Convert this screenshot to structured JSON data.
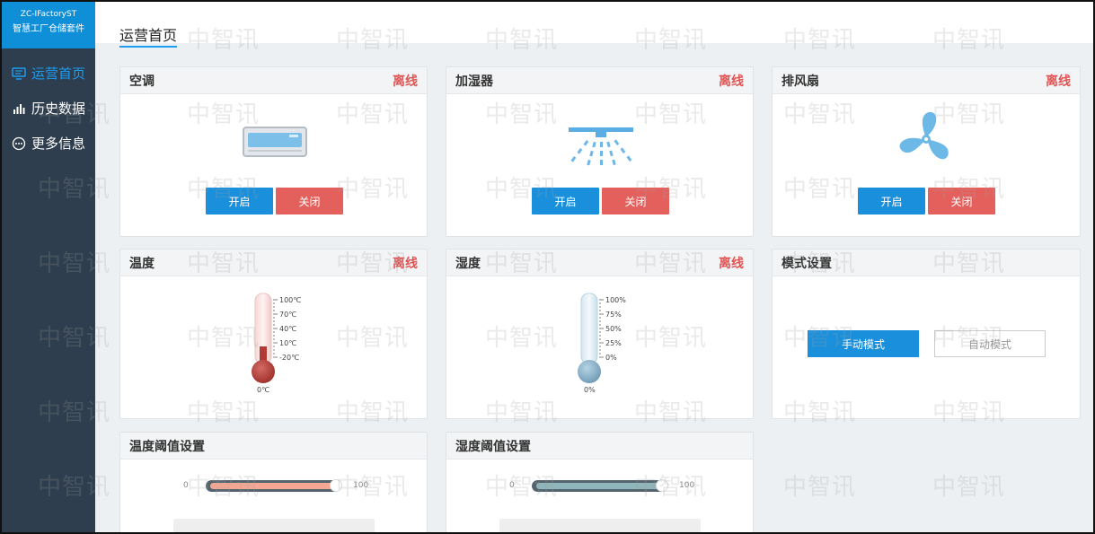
{
  "sidebar": {
    "brand_line1": "ZC-IFactoryST",
    "brand_line2": "智慧工厂仓储套件",
    "items": [
      {
        "label": "运营首页",
        "icon": "monitor-icon",
        "active": true
      },
      {
        "label": "历史数据",
        "icon": "bar-chart-icon",
        "active": false
      },
      {
        "label": "更多信息",
        "icon": "more-dots-icon",
        "active": false
      }
    ]
  },
  "header": {
    "tab": "运营首页"
  },
  "watermark": "中智讯",
  "devices": {
    "ac": {
      "title": "空调",
      "status": "离线",
      "on_label": "开启",
      "off_label": "关闭",
      "icon": "air-conditioner-icon"
    },
    "humidifier": {
      "title": "加湿器",
      "status": "离线",
      "on_label": "开启",
      "off_label": "关闭",
      "icon": "sprinkler-icon"
    },
    "fan": {
      "title": "排风扇",
      "status": "离线",
      "on_label": "开启",
      "off_label": "关闭",
      "icon": "fan-icon"
    }
  },
  "temperature": {
    "title": "温度",
    "status": "离线",
    "scale": [
      "100℃",
      "70℃",
      "40℃",
      "10℃",
      "-20℃"
    ],
    "value_label": "0℃",
    "color": "#b23a35"
  },
  "humidity": {
    "title": "湿度",
    "status": "离线",
    "scale": [
      "100%",
      "75%",
      "50%",
      "25%",
      "0%"
    ],
    "value_label": "0%",
    "color": "#7fb3cf"
  },
  "mode": {
    "title": "模式设置",
    "manual_label": "手动模式",
    "auto_label": "自动模式",
    "selected": "manual"
  },
  "temp_threshold": {
    "title": "温度阈值设置",
    "min": "0",
    "max": "100",
    "value_fraction": 1.0,
    "color": "#f4a894"
  },
  "humid_threshold": {
    "title": "湿度阈值设置",
    "min": "0",
    "max": "100",
    "value_fraction": 1.0,
    "color": "#8fb6ba"
  },
  "colors": {
    "accent": "#1a90dc",
    "danger": "#e05555",
    "sidebar": "#2e3e4e"
  }
}
